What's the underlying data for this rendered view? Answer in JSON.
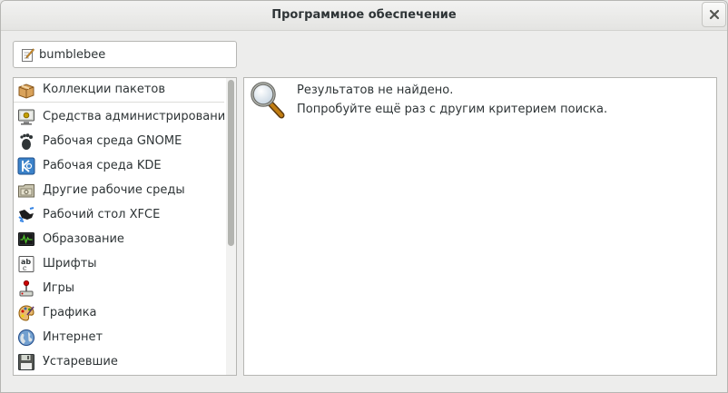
{
  "window": {
    "title": "Программное обеспечение"
  },
  "search": {
    "value": "bumblebee",
    "icon": "pencil-icon"
  },
  "categories": [
    {
      "label": "Коллекции пакетов",
      "icon": "package-box-icon"
    },
    {
      "label": "Средства администрирования",
      "icon": "admin-monitor-icon"
    },
    {
      "label": "Рабочая среда GNOME",
      "icon": "gnome-foot-icon"
    },
    {
      "label": "Рабочая среда KDE",
      "icon": "kde-icon"
    },
    {
      "label": "Другие рабочие среды",
      "icon": "folder-desktop-icon"
    },
    {
      "label": "Рабочий стол XFCE",
      "icon": "xfce-mouse-icon"
    },
    {
      "label": "Образование",
      "icon": "education-monitor-icon"
    },
    {
      "label": "Шрифты",
      "icon": "fonts-icon"
    },
    {
      "label": "Игры",
      "icon": "joystick-icon"
    },
    {
      "label": "Графика",
      "icon": "palette-icon"
    },
    {
      "label": "Интернет",
      "icon": "globe-icon"
    },
    {
      "label": "Устаревшие",
      "icon": "floppy-icon"
    }
  ],
  "results": {
    "message_title": "Результатов не найдено.",
    "message_hint": "Попробуйте ещё раз с другим критерием поиска.",
    "icon": "magnifier-icon"
  }
}
